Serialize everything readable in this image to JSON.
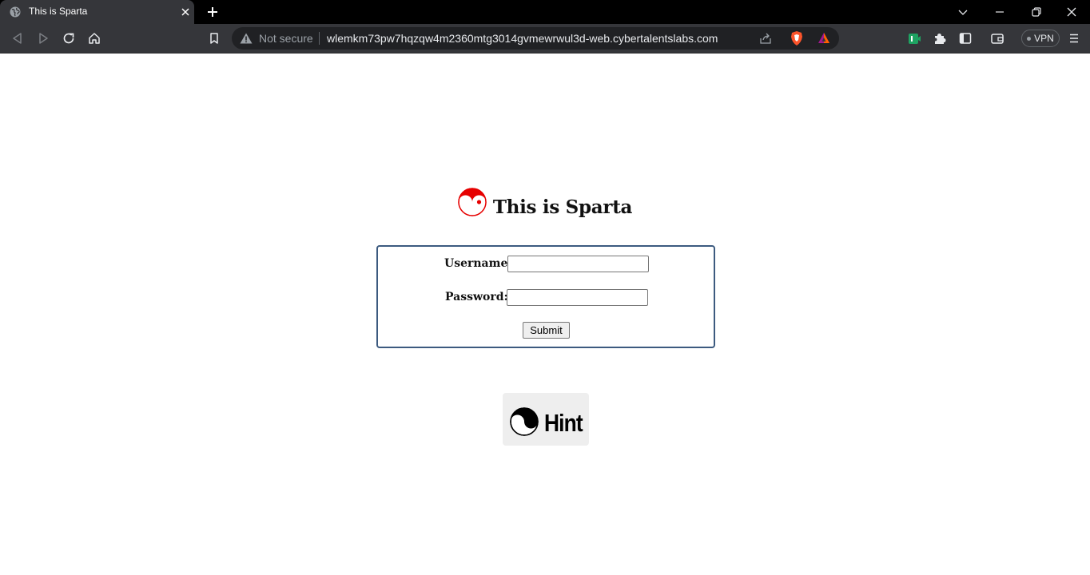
{
  "browser": {
    "tab": {
      "title": "This is Sparta",
      "favicon": "globe-icon"
    },
    "omnibox": {
      "security_label": "Not secure",
      "url": "wlemkm73pw7hqzqw4m2360mtg3014gvmewrwul3d-web.cybertalentslabs.com"
    },
    "vpn_label": "VPN",
    "icons": [
      "back-icon",
      "forward-icon",
      "reload-icon",
      "home-icon",
      "bookmark-icon",
      "warning-icon",
      "share-icon",
      "brave-shield-icon",
      "brave-rewards-icon",
      "extension-icon",
      "puzzle-icon",
      "sidebar-icon",
      "wallet-icon",
      "menu-icon",
      "minimize-icon",
      "restore-icon",
      "close-icon",
      "tab-search-icon",
      "new-tab-icon"
    ]
  },
  "page": {
    "heading": "This is Sparta",
    "heading_icon": "yin-yang-icon",
    "heading_icon_color": "#e60000",
    "form": {
      "username_label": "Username:",
      "username_value": "",
      "password_label": "Password:",
      "password_value": "",
      "submit_label": "Submit",
      "border_color": "#3c5a7f"
    },
    "hint": {
      "label": "Hint",
      "icon": "yin-yang-icon"
    }
  }
}
